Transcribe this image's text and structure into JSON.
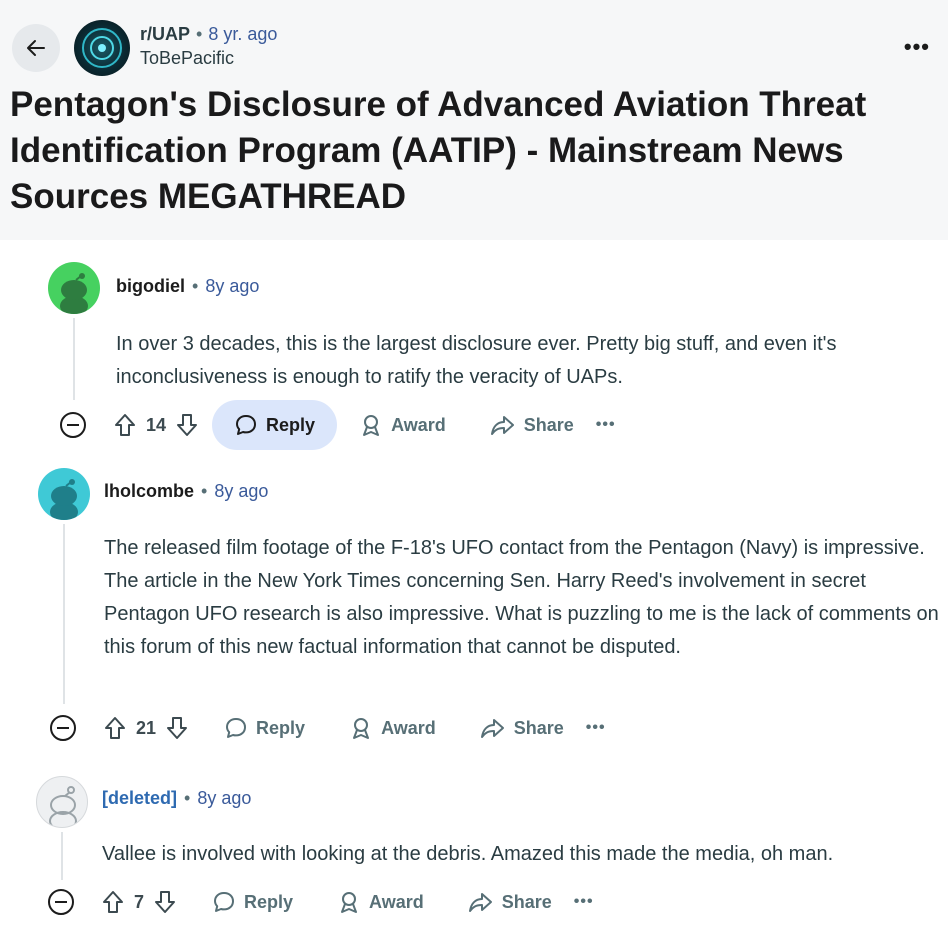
{
  "post": {
    "subreddit": "r/UAP",
    "time": "8 yr. ago",
    "author": "ToBePacific",
    "title": "Pentagon's Disclosure of Advanced Aviation Threat Identification Program (AATIP) - Mainstream News Sources MEGATHREAD"
  },
  "comments": [
    {
      "user": "bigodiel",
      "time": "8y ago",
      "body": "In over 3 decades, this is the largest disclosure ever. Pretty big stuff, and even it's inconclusiveness is enough to ratify the veracity of UAPs.",
      "votes": "14",
      "reply": "Reply",
      "award": "Award",
      "share": "Share",
      "more": "•••"
    },
    {
      "user": "lholcombe",
      "time": "8y ago",
      "body": "The released film footage of the F-18's UFO contact from the Pentagon (Navy) is impressive. The article in the New York Times concerning Sen. Harry Reed's involvement in secret Pentagon UFO research is also impressive. What is puzzling to me is the lack of comments on this forum of this new factual information that cannot be disputed.",
      "votes": "21",
      "reply": "Reply",
      "award": "Award",
      "share": "Share",
      "more": "•••"
    },
    {
      "user": "[deleted]",
      "time": "8y ago",
      "body": "Vallee is involved with looking at the debris. Amazed this made the media, oh man.",
      "votes": "7",
      "reply": "Reply",
      "award": "Award",
      "share": "Share",
      "more": "•••"
    }
  ],
  "ui": {
    "more_top": "•••",
    "sep": "•"
  },
  "icons": [
    "back-arrow-icon",
    "subreddit-avatar-icon",
    "upvote-icon",
    "downvote-icon",
    "reply-bubble-icon",
    "award-icon",
    "share-icon",
    "collapse-icon",
    "more-icon"
  ]
}
